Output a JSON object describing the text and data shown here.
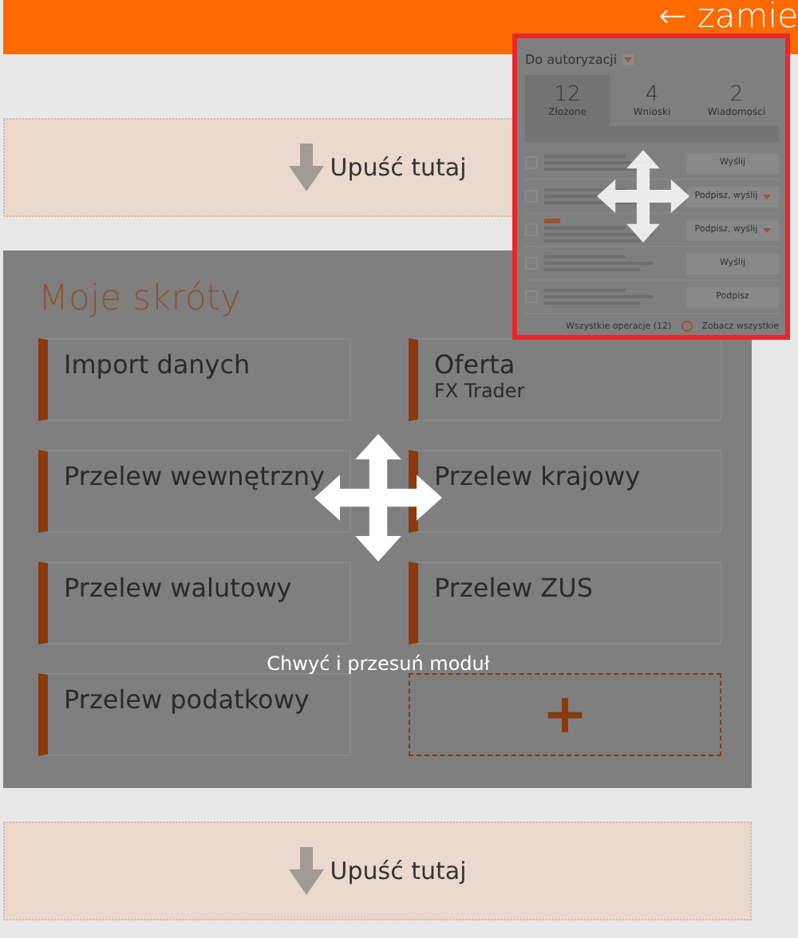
{
  "top_bar": {
    "link": "← zamie"
  },
  "drop_zones": [
    {
      "label": "Upuść tutaj"
    },
    {
      "label": "Upuść tutaj"
    }
  ],
  "module": {
    "title": "Moje skróty",
    "tiles": [
      {
        "kind": "shortcut",
        "label": "Import danych"
      },
      {
        "kind": "shortcut",
        "label": "Oferta",
        "sublabel": "FX Trader"
      },
      {
        "kind": "shortcut",
        "label": "Przelew wewnętrzny"
      },
      {
        "kind": "shortcut",
        "label": "Przelew krajowy"
      },
      {
        "kind": "shortcut",
        "label": "Przelew walutowy"
      },
      {
        "kind": "shortcut",
        "label": "Przelew ZUS"
      },
      {
        "kind": "shortcut",
        "label": "Przelew podatkowy"
      },
      {
        "kind": "add",
        "label": "+"
      }
    ]
  },
  "drag_hint": "Chwyć i przesuń moduł",
  "dragged_module": {
    "title": "Do autoryzacji",
    "tabs": [
      {
        "count": "12",
        "label": "Złożone",
        "selected": true
      },
      {
        "count": "4",
        "label": "Wnioski",
        "selected": false
      },
      {
        "count": "2",
        "label": "Wiadomości",
        "selected": false
      }
    ],
    "rows": [
      {
        "action": "Wyślij",
        "dropdown": false,
        "tagged": false,
        "checked": false
      },
      {
        "action": "Podpisz, wyślij",
        "dropdown": true,
        "tagged": false,
        "checked": false
      },
      {
        "action": "Podpisz, wyślij",
        "dropdown": true,
        "tagged": true,
        "checked": false
      },
      {
        "action": "Wyślij",
        "dropdown": false,
        "tagged": false,
        "checked": false
      },
      {
        "action": "Podpisz",
        "dropdown": false,
        "tagged": false,
        "checked": false
      }
    ],
    "footer_link": "Wszystkie operacje (12)",
    "settings_link": "Zobacz wszystkie"
  }
}
